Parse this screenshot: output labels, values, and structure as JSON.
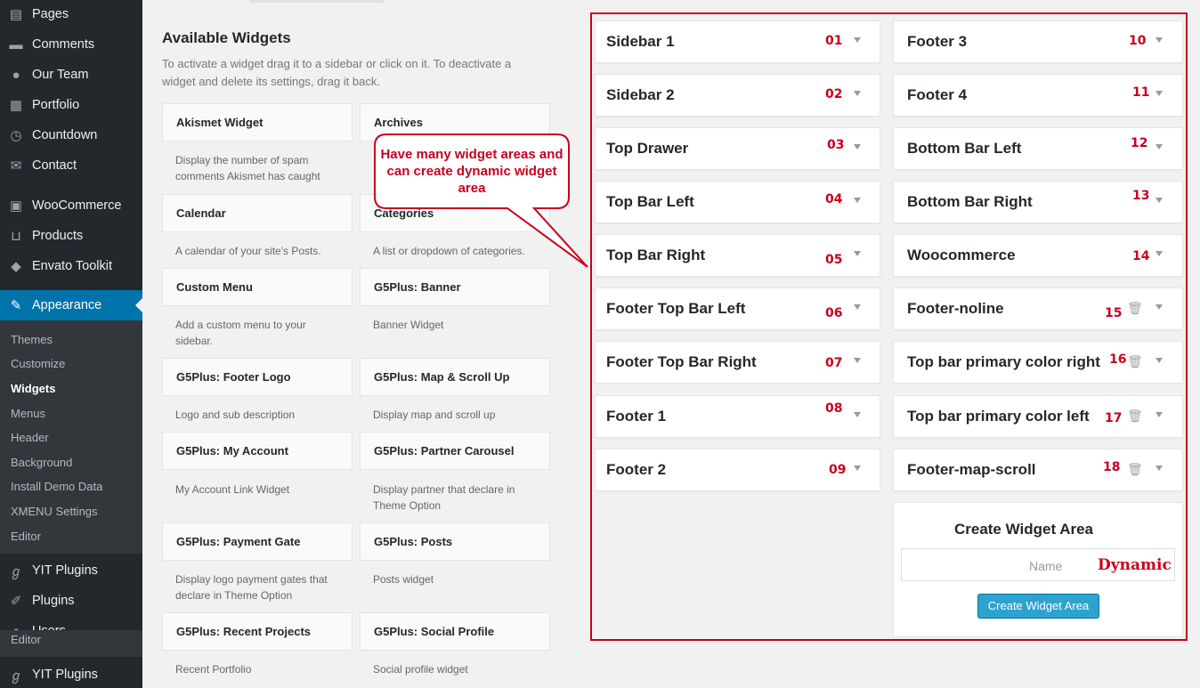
{
  "menu": {
    "pages": "Pages",
    "comments": "Comments",
    "our_team": "Our Team",
    "portfolio": "Portfolio",
    "countdown": "Countdown",
    "contact": "Contact",
    "woocommerce": "WooCommerce",
    "products": "Products",
    "envato": "Envato Toolkit",
    "appearance": "Appearance",
    "yit_plugins": "YIT Plugins",
    "plugins": "Plugins",
    "users": "Users",
    "flyout_editor": "Editor",
    "yit_plugins_2": "YIT Plugins"
  },
  "submenu": [
    "Themes",
    "Customize",
    "Widgets",
    "Menus",
    "Header",
    "Background",
    "Install Demo Data",
    "XMENU Settings",
    "Editor"
  ],
  "available": {
    "heading": "Available Widgets",
    "description": "To activate a widget drag it to a sidebar or click on it. To deactivate a widget and delete its settings, drag it back."
  },
  "widgets": [
    {
      "name": "Akismet Widget",
      "desc": "Display the number of spam comments Akismet has caught"
    },
    {
      "name": "Archives",
      "desc": ""
    },
    {
      "name": "Calendar",
      "desc": "A calendar of your site's Posts."
    },
    {
      "name": "Categories",
      "desc": "A list or dropdown of categories."
    },
    {
      "name": "Custom Menu",
      "desc": "Add a custom menu to your sidebar."
    },
    {
      "name": "G5Plus: Banner",
      "desc": "Banner Widget"
    },
    {
      "name": "G5Plus: Footer Logo",
      "desc": "Logo and sub description"
    },
    {
      "name": "G5Plus: Map & Scroll Up",
      "desc": "Display map and scroll up"
    },
    {
      "name": "G5Plus: My Account",
      "desc": "My Account Link Widget"
    },
    {
      "name": "G5Plus: Partner Carousel",
      "desc": "Display partner that declare in Theme Option"
    },
    {
      "name": "G5Plus: Payment Gate",
      "desc": "Display logo payment gates that declare in Theme Option"
    },
    {
      "name": "G5Plus: Posts",
      "desc": "Posts widget"
    },
    {
      "name": "G5Plus: Recent Projects",
      "desc": "Recent Portfolio"
    },
    {
      "name": "G5Plus: Social Profile",
      "desc": "Social profile widget"
    }
  ],
  "callout": "Have many widget areas and can create dynamic widget area",
  "sidebars": [
    {
      "title": "Sidebar 1",
      "num": "01"
    },
    {
      "title": "Sidebar 2",
      "num": "02"
    },
    {
      "title": "Top Drawer",
      "num": "03"
    },
    {
      "title": "Top Bar Left",
      "num": "04"
    },
    {
      "title": "Top Bar Right",
      "num": "05"
    },
    {
      "title": "Footer Top Bar Left",
      "num": "06"
    },
    {
      "title": "Footer Top Bar Right",
      "num": "07"
    },
    {
      "title": "Footer 1",
      "num": "08"
    },
    {
      "title": "Footer 2",
      "num": "09"
    },
    {
      "title": "Footer 3",
      "num": "10"
    },
    {
      "title": "Footer 4",
      "num": "11"
    },
    {
      "title": "Bottom Bar Left",
      "num": "12"
    },
    {
      "title": "Bottom Bar Right",
      "num": "13"
    },
    {
      "title": "Woocommerce",
      "num": "14"
    },
    {
      "title": "Footer-noline",
      "num": "15"
    },
    {
      "title": "Top bar primary color right",
      "num": "16"
    },
    {
      "title": "Top bar primary color left",
      "num": "17"
    },
    {
      "title": "Footer-map-scroll",
      "num": "18"
    }
  ],
  "create": {
    "title": "Create Widget Area",
    "placeholder": "Name",
    "annotation": "Dynamic",
    "button": "Create Widget Area"
  },
  "colors": {
    "accent": "#0073aa",
    "annotation_red": "#c8001e",
    "button": "#2ea2cc"
  }
}
